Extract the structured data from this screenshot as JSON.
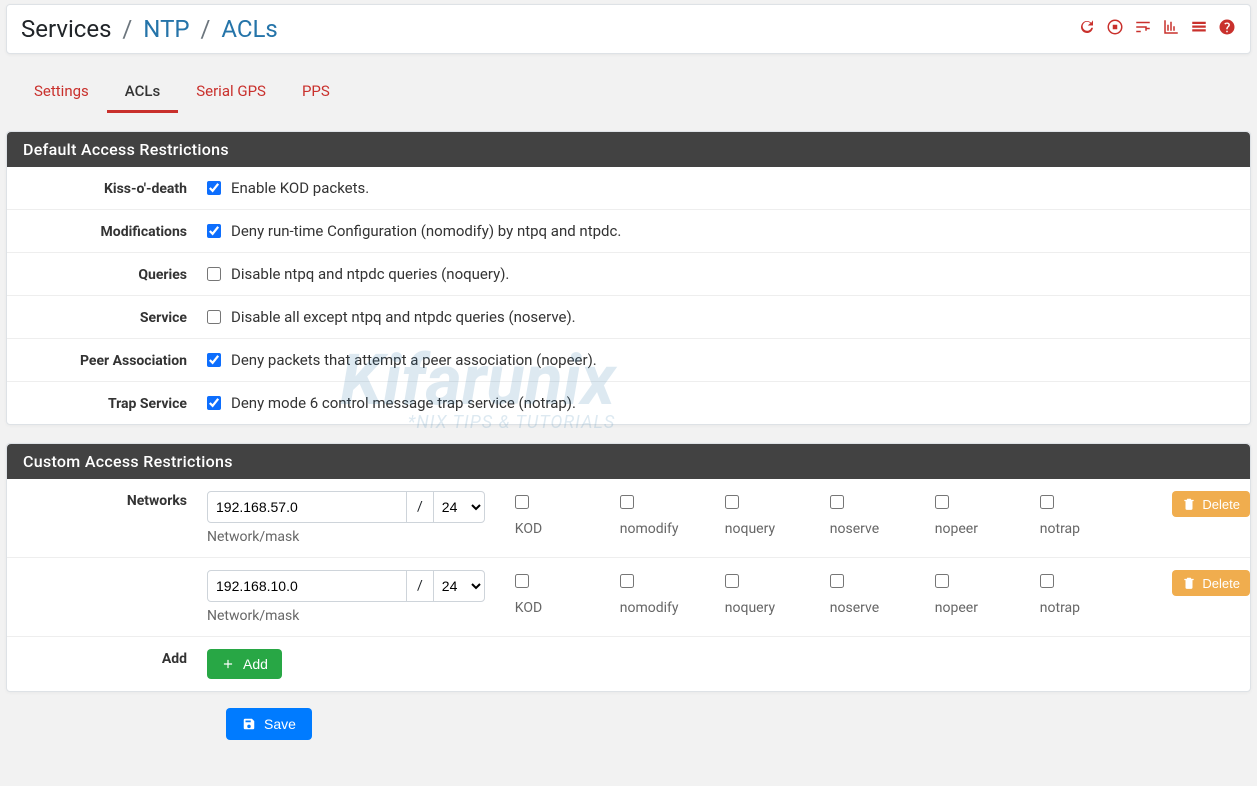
{
  "breadcrumb": {
    "root": "Services",
    "lvl1": "NTP",
    "lvl2": "ACLs"
  },
  "tabs": {
    "settings": "Settings",
    "acls": "ACLs",
    "serial_gps": "Serial GPS",
    "pps": "PPS"
  },
  "panel1": {
    "title": "Default Access Restrictions",
    "rows": {
      "kod": {
        "label": "Kiss-o'-death",
        "text": "Enable KOD packets.",
        "checked": true
      },
      "modifications": {
        "label": "Modifications",
        "text": "Deny run-time Configuration (nomodify) by ntpq and ntpdc.",
        "checked": true
      },
      "queries": {
        "label": "Queries",
        "text": "Disable ntpq and ntpdc queries (noquery).",
        "checked": false
      },
      "service": {
        "label": "Service",
        "text": "Disable all except ntpq and ntpdc queries (noserve).",
        "checked": false
      },
      "peer": {
        "label": "Peer Association",
        "text": "Deny packets that attempt a peer association (nopeer).",
        "checked": true
      },
      "trap": {
        "label": "Trap Service",
        "text": "Deny mode 6 control message trap service (notrap).",
        "checked": true
      }
    }
  },
  "panel2": {
    "title": "Custom Access Restrictions",
    "networks_label": "Networks",
    "add_label": "Add",
    "helptext": "Network/mask",
    "slash": "/",
    "cols": {
      "kod": "KOD",
      "nomodify": "nomodify",
      "noquery": "noquery",
      "noserve": "noserve",
      "nopeer": "nopeer",
      "notrap": "notrap"
    },
    "rows": [
      {
        "network": "192.168.57.0",
        "mask": "24"
      },
      {
        "network": "192.168.10.0",
        "mask": "24"
      }
    ],
    "delete_label": "Delete",
    "add_btn": "Add"
  },
  "save_label": "Save",
  "watermark": {
    "main": "Kifarunix",
    "sub": "*NIX TIPS & TUTORIALS"
  }
}
